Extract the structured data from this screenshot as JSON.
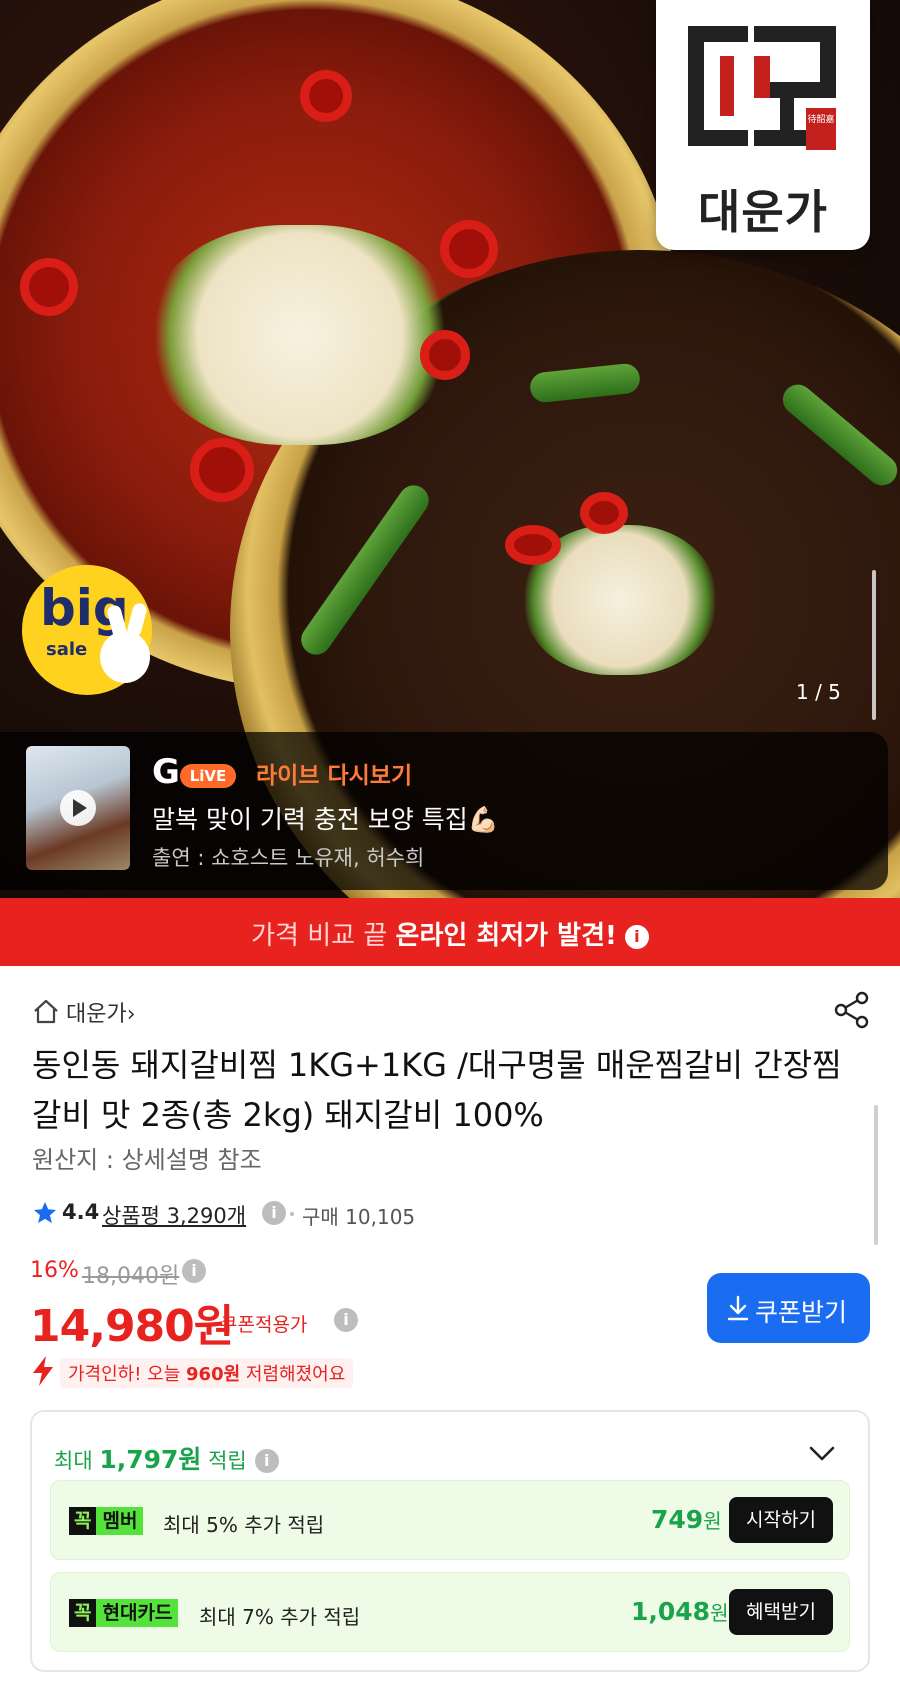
{
  "hero": {
    "brand_name": "대운가",
    "brand_seal": "待韶嘉",
    "badge_big": "big",
    "badge_sale": "sale",
    "image_counter": "1 / 5"
  },
  "live": {
    "logo_letter": "G",
    "logo_pill": "LiVE",
    "label": "라이브 다시보기",
    "title": "말복 맞이 기력 충전 보양 특집💪🏻",
    "cast": "출연 : 쇼호스트 노유재, 허수희"
  },
  "promo": {
    "prefix": "가격 비교 끝 ",
    "highlight": "온라인 최저가 발견!",
    "info": "i"
  },
  "product": {
    "store": "대운가",
    "store_chevron": "›",
    "title": "동인동 돼지갈비찜 1KG+1KG /대구명물 매운찜갈비 간장찜갈비 맛 2종(총 2kg) 돼지갈비 100%",
    "origin": "원산지 : 상세설명 참조",
    "rating": "4.4",
    "review_label": "상품평 3,290개",
    "purchase": "구매 10,105",
    "info": "i"
  },
  "pricing": {
    "discount_pct": "16%",
    "original_price": "18,040원",
    "price": "14,980원",
    "coupon_applied": "쿠폰적용가",
    "coupon_button": "쿠폰받기",
    "drop_prefix": "가격인하! 오늘 ",
    "drop_amount": "960원",
    "drop_suffix": " 저렴해졌어요"
  },
  "rewards": {
    "prefix": "최대 ",
    "amount": "1,797원",
    "suffix": " 적립",
    "items": [
      {
        "tag_k": "꼭",
        "tag_name": "멤버",
        "desc": "최대 5% 추가 적립",
        "amount": "749",
        "unit": "원",
        "button": "시작하기"
      },
      {
        "tag_k": "꼭",
        "tag_name": "현대카드",
        "desc": "최대 7% 추가 적립",
        "amount": "1,048",
        "unit": "원",
        "button": "혜택받기"
      }
    ]
  },
  "colors": {
    "accent_red": "#e8231f",
    "coupon_blue": "#1a6cf0",
    "reward_green": "#1aa34a",
    "live_orange": "#ff6a2a",
    "badge_yellow": "#ffd21f"
  }
}
